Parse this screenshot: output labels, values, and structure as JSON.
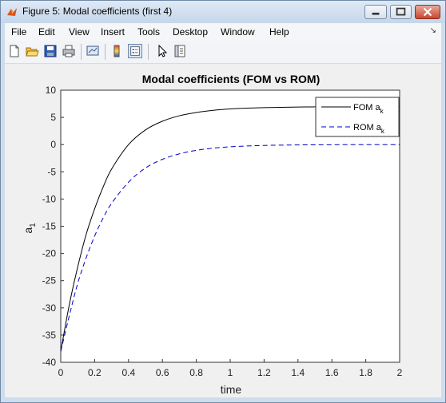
{
  "window": {
    "title": "Figure 5: Modal coefficients (first 4)"
  },
  "menu": [
    "File",
    "Edit",
    "View",
    "Insert",
    "Tools",
    "Desktop",
    "Window",
    "Help"
  ],
  "toolbar": [
    "new-figure-icon",
    "open-file-icon",
    "save-icon",
    "print-icon",
    "link-plot-icon",
    "insert-colorbar-icon",
    "insert-legend-icon",
    "pointer-icon",
    "property-inspector-icon"
  ],
  "chart_data": {
    "type": "line",
    "title": "Modal coefficients (FOM vs ROM)",
    "xlabel": "time",
    "ylabel": "a",
    "ylabel_sub": "1",
    "xlim": [
      0,
      2
    ],
    "ylim": [
      -40,
      10
    ],
    "xticks": [
      "0",
      "0.2",
      "0.4",
      "0.6",
      "0.8",
      "1",
      "1.2",
      "1.4",
      "1.6",
      "1.8",
      "2"
    ],
    "yticks": [
      "10",
      "5",
      "0",
      "-5",
      "-10",
      "-15",
      "-20",
      "-25",
      "-30",
      "-35",
      "-40"
    ],
    "legend": {
      "position": "top-right",
      "entries": [
        {
          "text": "FOM a",
          "sub": "k"
        },
        {
          "text": "ROM a",
          "sub": "k"
        }
      ]
    },
    "series": [
      {
        "name": "FOM a_k",
        "color": "#000000",
        "style": "solid",
        "x": [
          0,
          0.05,
          0.1,
          0.15,
          0.2,
          0.25,
          0.3,
          0.4,
          0.5,
          0.6,
          0.7,
          0.8,
          0.9,
          1.0,
          1.1,
          1.2,
          1.3,
          1.4,
          1.5,
          1.6,
          1.7,
          1.8,
          1.9,
          2.0
        ],
        "y": [
          -38,
          -29.5,
          -22.5,
          -16.5,
          -11.8,
          -7.8,
          -4.5,
          0.0,
          2.7,
          4.3,
          5.3,
          5.9,
          6.3,
          6.55,
          6.7,
          6.8,
          6.85,
          6.9,
          6.93,
          6.95,
          6.97,
          6.98,
          6.99,
          7.0
        ]
      },
      {
        "name": "ROM a_k",
        "color": "#0000cc",
        "style": "dashed",
        "x": [
          0,
          0.05,
          0.1,
          0.15,
          0.2,
          0.25,
          0.3,
          0.4,
          0.5,
          0.6,
          0.7,
          0.8,
          0.9,
          1.0,
          1.1,
          1.2,
          1.3,
          1.4,
          1.5,
          1.6,
          1.7,
          1.8,
          1.9,
          2.0
        ],
        "y": [
          -38,
          -31.5,
          -25.5,
          -20.8,
          -16.8,
          -13.5,
          -10.8,
          -6.9,
          -4.3,
          -2.7,
          -1.7,
          -1.05,
          -0.65,
          -0.4,
          -0.25,
          -0.15,
          -0.1,
          -0.06,
          -0.04,
          -0.02,
          -0.01,
          0,
          0,
          0
        ]
      }
    ]
  }
}
